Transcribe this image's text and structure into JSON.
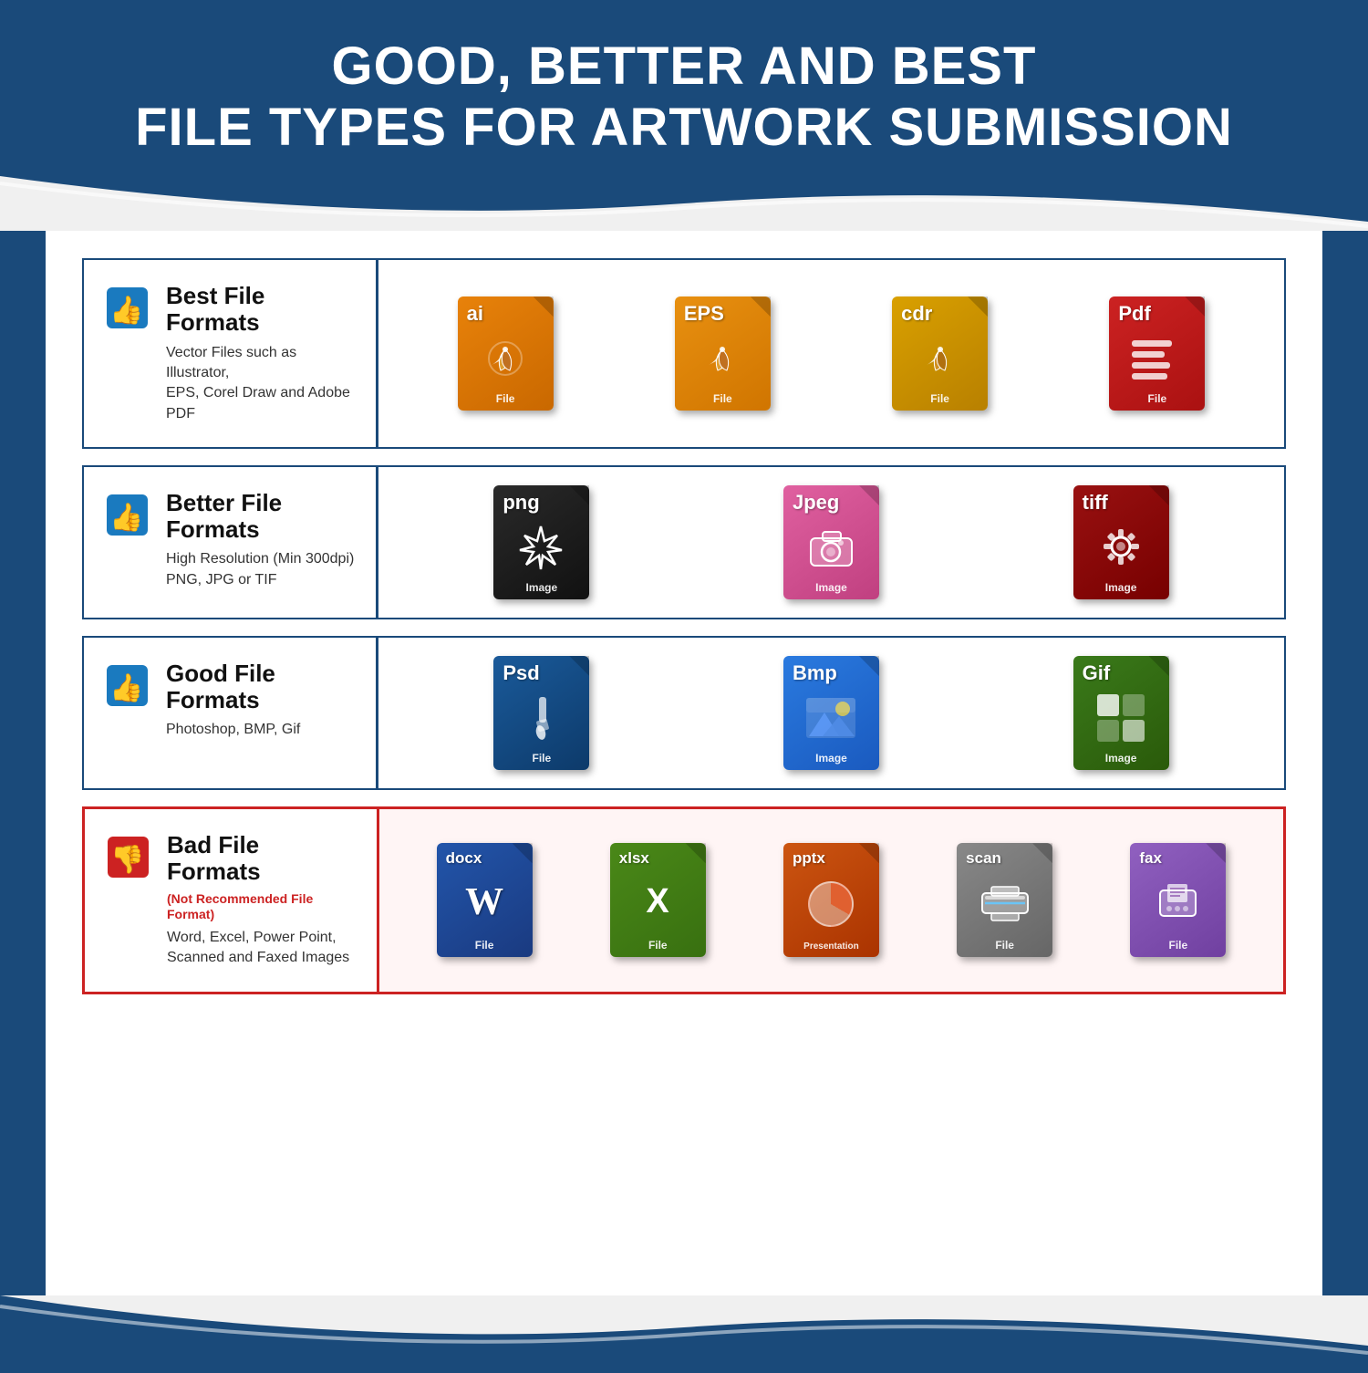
{
  "header": {
    "line1": "GOOD, BETTER AND BEST",
    "line2": "FILE TYPES FOR ARTWORK SUBMISSION",
    "bg_color": "#1a4a7a"
  },
  "sections": [
    {
      "id": "best",
      "rating": "best",
      "thumbs": "up",
      "title": "Best File Formats",
      "subtitle": null,
      "description": "Vector Files such as Illustrator,\nEPS, Corel Draw and Adobe PDF",
      "border_color": "#1a4a7a",
      "files": [
        {
          "ext": "ai",
          "label": "File",
          "color": "orange",
          "icon": "pen"
        },
        {
          "ext": "EPS",
          "label": "File",
          "color": "orange2",
          "icon": "pen"
        },
        {
          "ext": "cdr",
          "label": "File",
          "color": "orange3",
          "icon": "pen"
        },
        {
          "ext": "Pdf",
          "label": "File",
          "color": "red",
          "icon": "doc"
        }
      ]
    },
    {
      "id": "better",
      "rating": "better",
      "thumbs": "up",
      "title": "Better File Formats",
      "subtitle": null,
      "description": "High Resolution (Min 300dpi)\nPNG, JPG or TIF",
      "border_color": "#1a4a7a",
      "files": [
        {
          "ext": "png",
          "label": "Image",
          "color": "dark",
          "icon": "star"
        },
        {
          "ext": "Jpeg",
          "label": "Image",
          "color": "pink",
          "icon": "camera"
        },
        {
          "ext": "tiff",
          "label": "Image",
          "color": "darkred",
          "icon": "gear"
        }
      ]
    },
    {
      "id": "good",
      "rating": "good",
      "thumbs": "up",
      "title": "Good File Formats",
      "subtitle": null,
      "description": "Photoshop, BMP, Gif",
      "border_color": "#1a4a7a",
      "files": [
        {
          "ext": "Psd",
          "label": "File",
          "color": "navy",
          "icon": "brush"
        },
        {
          "ext": "Bmp",
          "label": "Image",
          "color": "blue",
          "icon": "landscape"
        },
        {
          "ext": "Gif",
          "label": "Image",
          "color": "green",
          "icon": "grid"
        }
      ]
    },
    {
      "id": "bad",
      "rating": "bad",
      "thumbs": "down",
      "title": "Bad File Formats",
      "subtitle": "(Not Recommended File Format)",
      "description": "Word, Excel, Power Point,\nScanned and Faxed Images",
      "border_color": "#cc2222",
      "files": [
        {
          "ext": "docx",
          "label": "File",
          "color": "blue2",
          "icon": "W"
        },
        {
          "ext": "xlsx",
          "label": "File",
          "color": "olive",
          "icon": "X"
        },
        {
          "ext": "pptx",
          "label": "Presentation",
          "color": "orange_bad",
          "icon": "pie"
        },
        {
          "ext": "scan",
          "label": "File",
          "color": "gray",
          "icon": "scan"
        },
        {
          "ext": "fax",
          "label": "File",
          "color": "purple",
          "icon": "fax"
        }
      ]
    }
  ]
}
